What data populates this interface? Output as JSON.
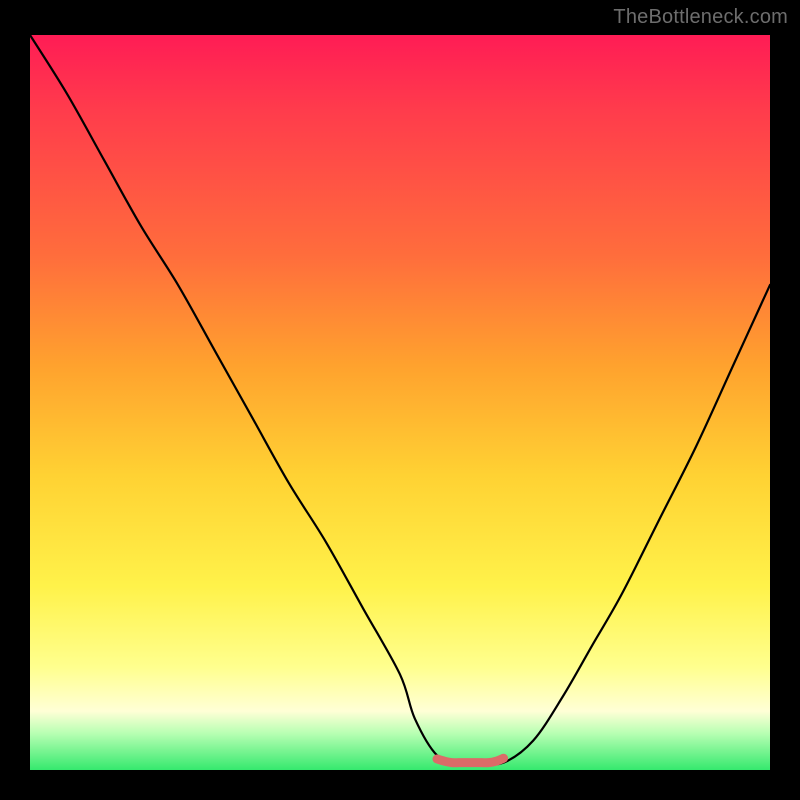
{
  "attribution": "TheBottleneck.com",
  "chart_data": {
    "type": "line",
    "title": "",
    "xlabel": "",
    "ylabel": "",
    "xlim": [
      0,
      100
    ],
    "ylim": [
      0,
      100
    ],
    "series": [
      {
        "name": "bottleneck-curve",
        "x": [
          0,
          5,
          10,
          15,
          20,
          25,
          30,
          35,
          40,
          45,
          50,
          52,
          55,
          58,
          61,
          64,
          68,
          72,
          76,
          80,
          85,
          90,
          95,
          100
        ],
        "values": [
          100,
          92,
          83,
          74,
          66,
          57,
          48,
          39,
          31,
          22,
          13,
          7,
          2,
          1,
          1,
          1,
          4,
          10,
          17,
          24,
          34,
          44,
          55,
          66
        ]
      },
      {
        "name": "optimal-flat-segment",
        "x": [
          55,
          56,
          57,
          58,
          59,
          60,
          61,
          62,
          63,
          64
        ],
        "values": [
          1.5,
          1.2,
          1.0,
          1.0,
          1.0,
          1.0,
          1.0,
          1.0,
          1.2,
          1.6
        ]
      }
    ],
    "colors": {
      "curve": "#000000",
      "optimal": "#db6b68",
      "gradient_top": "#ff1c55",
      "gradient_bottom": "#35e96e"
    }
  }
}
